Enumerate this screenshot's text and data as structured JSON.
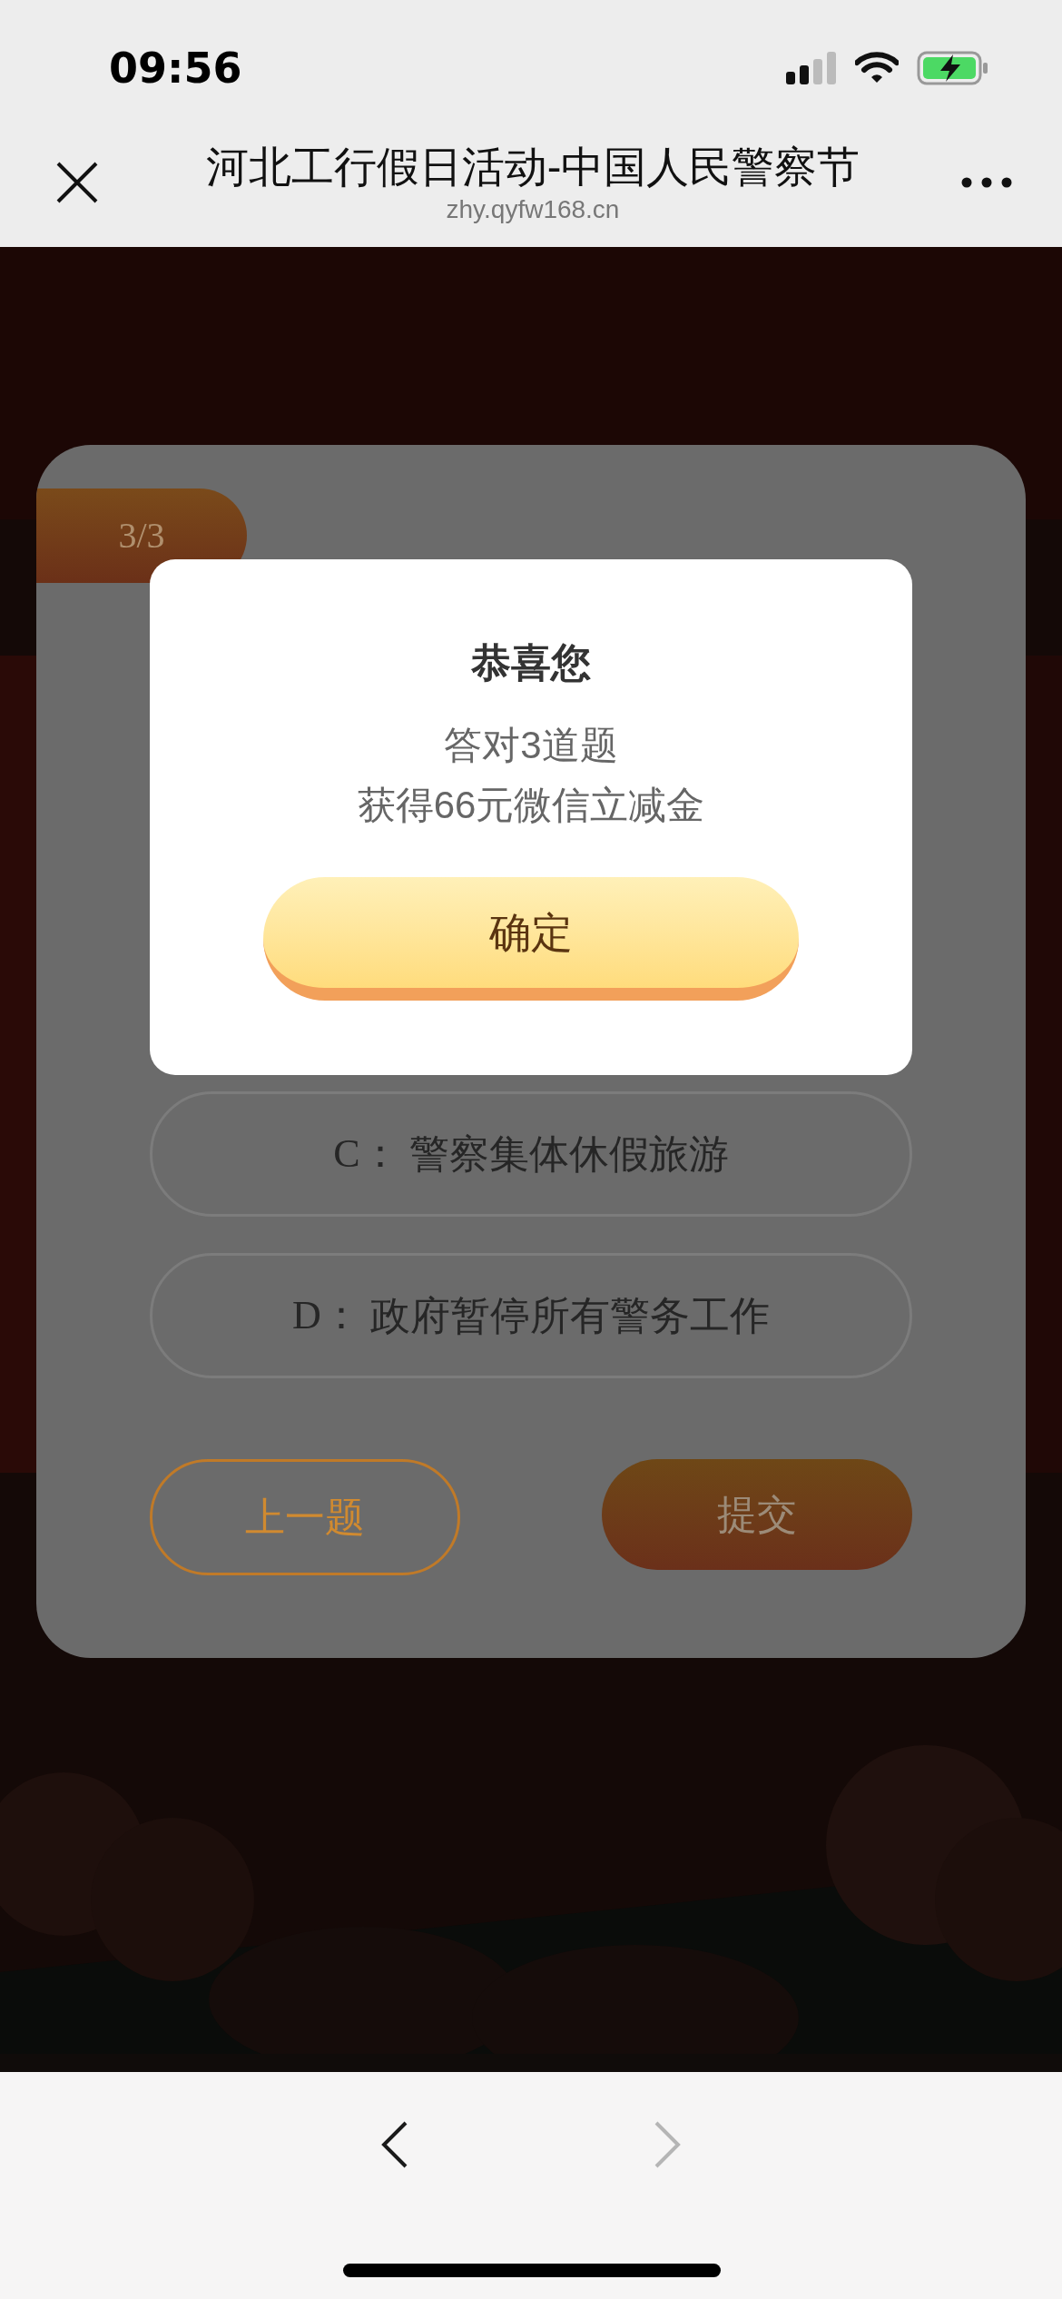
{
  "status_bar": {
    "time": "09:56"
  },
  "nav_bar": {
    "title": "河北工行假日活动-中国人民警察节",
    "url": "zhy.qyfw168.cn"
  },
  "quiz": {
    "progress": "3/3",
    "options": [
      {
        "letter": "C：",
        "text": "警察集体休假旅游"
      },
      {
        "letter": "D：",
        "text": "政府暂停所有警务工作"
      }
    ],
    "buttons": [
      {
        "kind": "outline",
        "label": "上一题"
      },
      {
        "kind": "filled",
        "label": "提交"
      }
    ]
  },
  "dialog": {
    "title": "恭喜您",
    "lines": [
      "答对3道题",
      "获得66元微信立减金"
    ],
    "button": "确定"
  },
  "browser_toolbar": {
    "back": {
      "disabled": false
    },
    "forward": {
      "disabled": true
    }
  }
}
